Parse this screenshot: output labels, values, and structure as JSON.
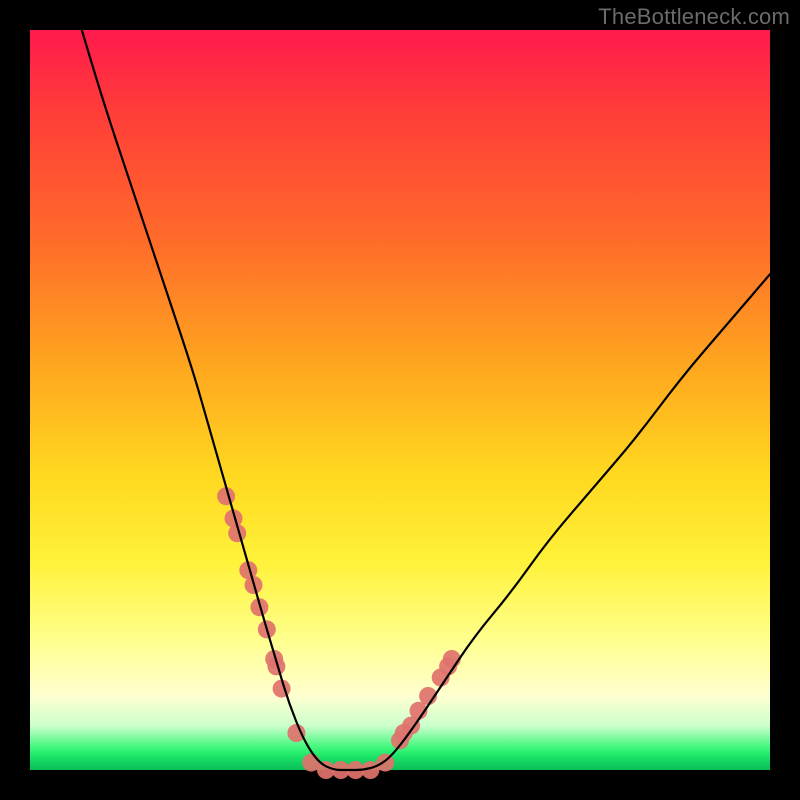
{
  "watermark": "TheBottleneck.com",
  "chart_data": {
    "type": "line",
    "title": "",
    "xlabel": "",
    "ylabel": "",
    "xlim": [
      0,
      100
    ],
    "ylim": [
      0,
      100
    ],
    "series": [
      {
        "name": "bottleneck-curve",
        "x": [
          7,
          10,
          14,
          18,
          22,
          24,
          26,
          28,
          30,
          32,
          33.5,
          35,
          37,
          39,
          41,
          43,
          45,
          47,
          49,
          52,
          56,
          60,
          65,
          70,
          76,
          82,
          88,
          94,
          100
        ],
        "values": [
          100,
          90,
          78,
          66,
          54,
          47,
          40,
          33,
          26,
          19,
          14,
          9,
          4,
          1,
          0,
          0,
          0,
          0.5,
          2,
          6,
          12,
          18,
          24,
          31,
          38,
          45,
          53,
          60,
          67
        ]
      }
    ],
    "markers": {
      "name": "highlight-dots",
      "x": [
        26.5,
        27.5,
        28,
        29.5,
        30.2,
        31,
        32,
        33,
        33.3,
        34,
        36,
        38,
        40,
        42,
        44,
        46,
        48,
        50,
        50.5,
        51.5,
        52.5,
        53.8,
        55.5,
        56.5,
        57
      ],
      "values": [
        37,
        34,
        32,
        27,
        25,
        22,
        19,
        15,
        14,
        11,
        5,
        1,
        0,
        0,
        0,
        0,
        1,
        4,
        5,
        6,
        8,
        10,
        12.5,
        14,
        15
      ],
      "color": "#e0726d",
      "radius": 9
    },
    "background_gradient": {
      "top": "#ff1a4d",
      "mid_upper": "#ffa51f",
      "mid": "#fff23a",
      "lower": "#ffffd0",
      "bottom": "#0abf57"
    }
  }
}
